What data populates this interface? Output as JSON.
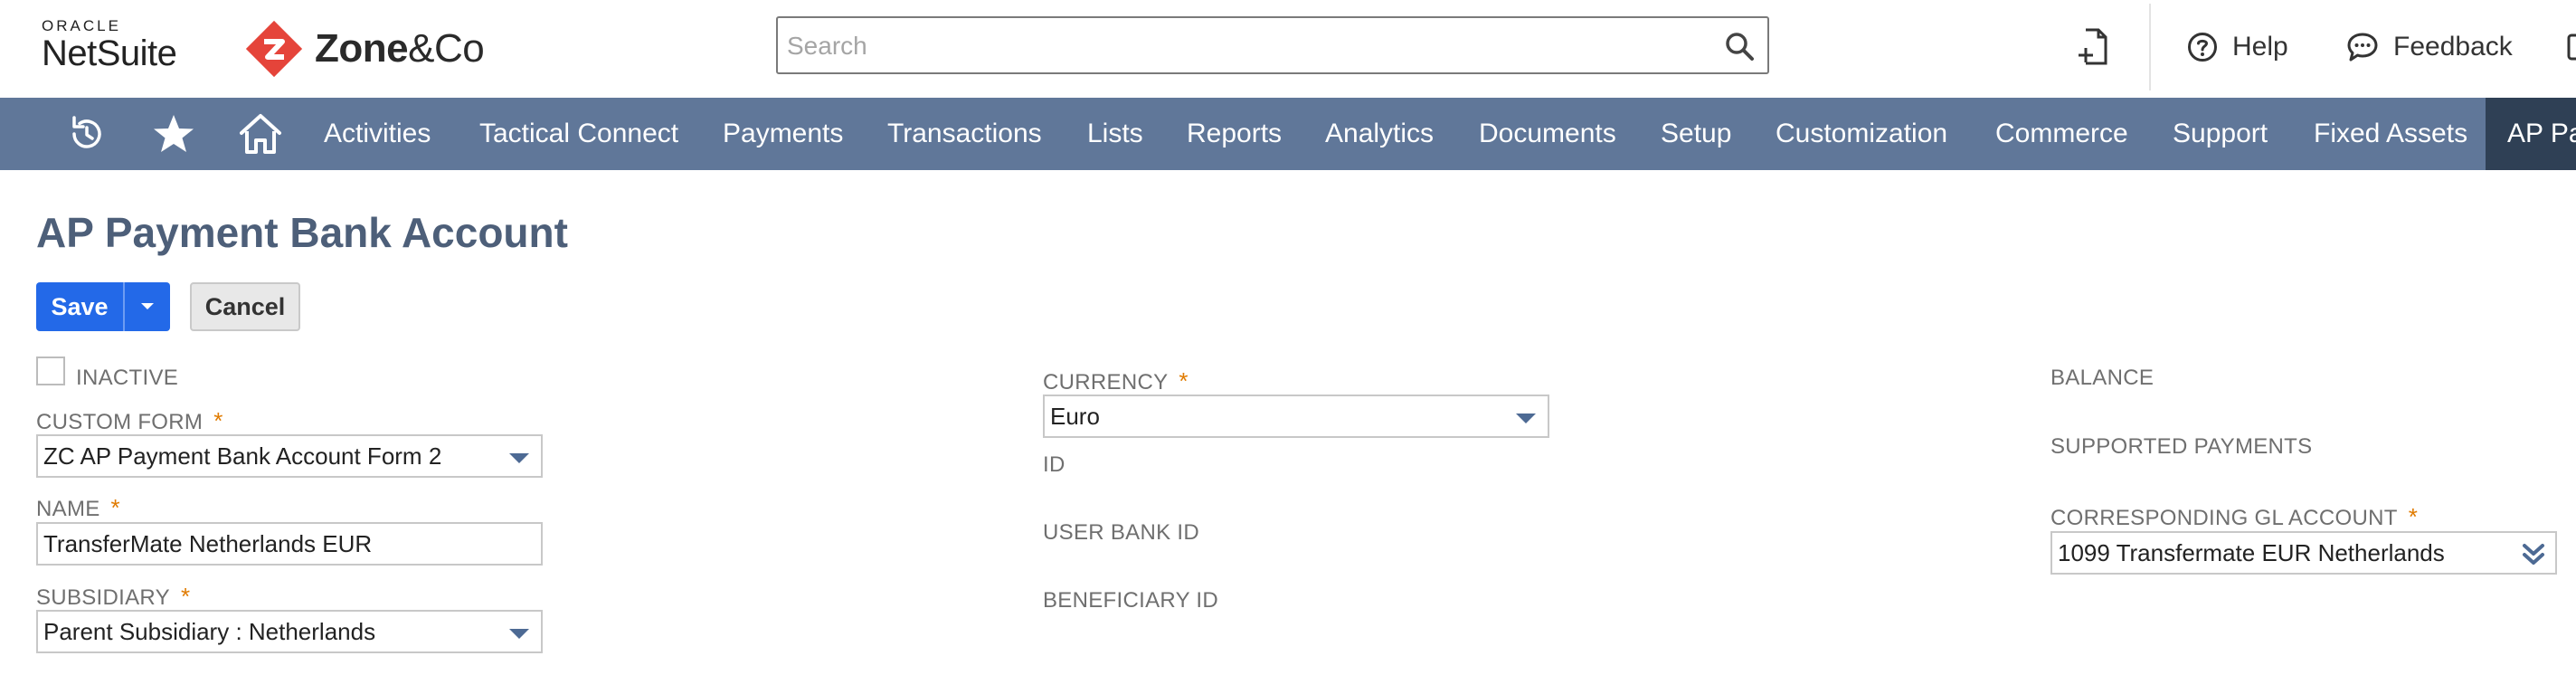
{
  "header": {
    "oracle_label": "ORACLE",
    "netsuite_label": "NetSuite",
    "brand": {
      "zone_bold": "Zone",
      "zone_rest": "&Co",
      "mark_color": "#e5443a"
    },
    "search": {
      "placeholder": "Search",
      "value": ""
    },
    "help_label": "Help",
    "feedback_label": "Feedback"
  },
  "nav": {
    "bg_color": "#607799",
    "icons": [
      "recent-records-icon",
      "star-icon",
      "home-icon"
    ],
    "items": [
      "Activities",
      "Tactical Connect",
      "Payments",
      "Transactions",
      "Lists",
      "Reports",
      "Analytics",
      "Documents",
      "Setup",
      "Customization",
      "Commerce",
      "Support",
      "Fixed Assets",
      "AP Pa"
    ]
  },
  "page": {
    "title": "AP Payment Bank Account",
    "save_label": "Save",
    "cancel_label": "Cancel",
    "accent_color": "#2369e8",
    "required_color": "#e07b00"
  },
  "form": {
    "inactive": {
      "label": "INACTIVE",
      "checked": false
    },
    "custom_form": {
      "label": "CUSTOM FORM",
      "value": "ZC AP Payment Bank Account Form 2"
    },
    "name": {
      "label": "NAME",
      "value": "TransferMate Netherlands EUR"
    },
    "subsidiary": {
      "label": "SUBSIDIARY",
      "value": "Parent Subsidiary : Netherlands"
    },
    "currency": {
      "label": "CURRENCY",
      "value": "Euro"
    },
    "id": {
      "label": "ID"
    },
    "user_bank_id": {
      "label": "USER BANK ID"
    },
    "beneficiary_id": {
      "label": "BENEFICIARY ID"
    },
    "balance": {
      "label": "BALANCE"
    },
    "supported_payments": {
      "label": "SUPPORTED PAYMENTS"
    },
    "corresponding_gl": {
      "label": "CORRESPONDING GL ACCOUNT",
      "value": "1099 Transfermate EUR Netherlands"
    }
  }
}
